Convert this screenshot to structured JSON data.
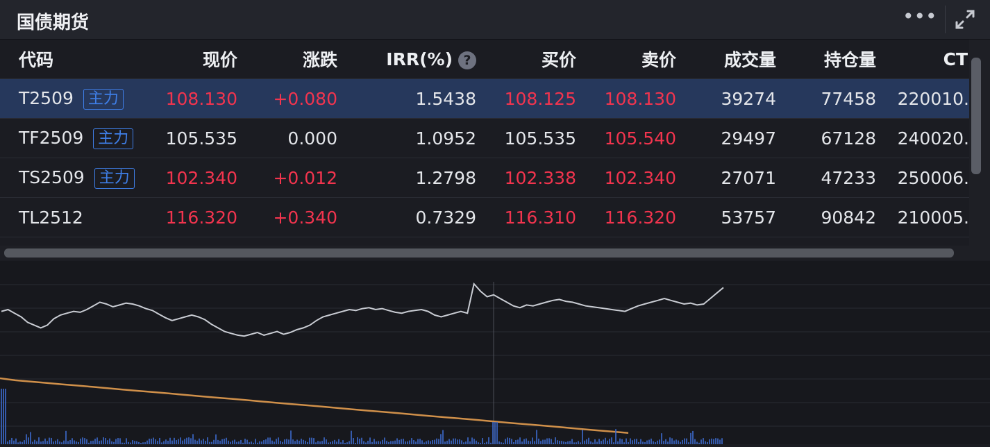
{
  "header": {
    "title": "国债期货",
    "more_icon": "more-horizontal-icon",
    "expand_icon": "expand-icon"
  },
  "table": {
    "columns": [
      "代码",
      "现价",
      "涨跌",
      "IRR(%)",
      "买价",
      "卖价",
      "成交量",
      "持仓量",
      "CT"
    ],
    "rows": [
      {
        "code": "T2509",
        "badge": "主力",
        "price": "108.130",
        "change": "+0.080",
        "irr": "1.5438",
        "bid": "108.125",
        "ask": "108.130",
        "volume": "39274",
        "open_interest": "77458",
        "ct": "220010."
      },
      {
        "code": "TF2509",
        "badge": "主力",
        "price": "105.535",
        "change": "0.000",
        "irr": "1.0952",
        "bid": "105.535",
        "ask": "105.540",
        "volume": "29497",
        "open_interest": "67128",
        "ct": "240020."
      },
      {
        "code": "TS2509",
        "badge": "主力",
        "price": "102.340",
        "change": "+0.012",
        "irr": "1.2798",
        "bid": "102.338",
        "ask": "102.340",
        "volume": "27071",
        "open_interest": "47233",
        "ct": "250006."
      },
      {
        "code": "TL2512",
        "badge": "",
        "price": "116.320",
        "change": "+0.340",
        "irr": "0.7329",
        "bid": "116.310",
        "ask": "116.320",
        "volume": "53757",
        "open_interest": "90842",
        "ct": "210005."
      }
    ]
  },
  "colors": {
    "up": "#f2344e",
    "accent": "#3f7fe8",
    "selected_row": "#26385c",
    "price_line": "#c9ccd3",
    "avg_line": "#d0904a",
    "volume_bar": "#3b66c4"
  },
  "chart_data": {
    "type": "line",
    "grid": true,
    "series": [
      {
        "values": [
          0.7,
          0.72,
          0.68,
          0.64,
          0.58,
          0.55,
          0.52,
          0.55,
          0.62,
          0.66,
          0.68,
          0.7,
          0.69,
          0.72,
          0.76,
          0.8,
          0.78,
          0.75,
          0.77,
          0.79,
          0.78,
          0.76,
          0.73,
          0.71,
          0.67,
          0.63,
          0.6,
          0.62,
          0.64,
          0.66,
          0.64,
          0.61,
          0.56,
          0.52,
          0.48,
          0.46,
          0.44,
          0.43,
          0.45,
          0.47,
          0.44,
          0.46,
          0.48,
          0.45,
          0.47,
          0.5,
          0.52,
          0.55,
          0.6,
          0.64,
          0.66,
          0.68,
          0.7,
          0.72,
          0.71,
          0.73,
          0.74,
          0.72,
          0.73,
          0.71,
          0.69,
          0.68,
          0.7,
          0.71,
          0.72,
          0.7,
          0.66,
          0.64,
          0.66,
          0.68,
          0.7,
          0.68,
          1.0,
          0.92,
          0.86,
          0.88,
          0.84,
          0.8,
          0.76,
          0.74,
          0.77,
          0.76,
          0.78,
          0.8,
          0.82,
          0.83,
          0.81,
          0.8,
          0.78,
          0.76,
          0.75,
          0.74,
          0.73,
          0.72,
          0.71,
          0.7,
          0.73,
          0.76,
          0.78,
          0.8,
          0.82,
          0.84,
          0.82,
          0.8,
          0.78,
          0.79,
          0.77,
          0.78,
          0.84,
          0.9,
          0.96
        ]
      },
      {
        "values": [
          1.0,
          0.97,
          0.95,
          0.93,
          0.91,
          0.89,
          0.87,
          0.85,
          0.83,
          0.81,
          0.79,
          0.77,
          0.75,
          0.73,
          0.71,
          0.69,
          0.67,
          0.65,
          0.63,
          0.61,
          0.59,
          0.57,
          0.55,
          0.53,
          0.51,
          0.49,
          0.47,
          0.45,
          0.43,
          0.41,
          0.39,
          0.37,
          0.35,
          0.33,
          0.31,
          0.29,
          0.27,
          0.25,
          0.23,
          0.21,
          0.19,
          0.17
        ]
      }
    ]
  }
}
